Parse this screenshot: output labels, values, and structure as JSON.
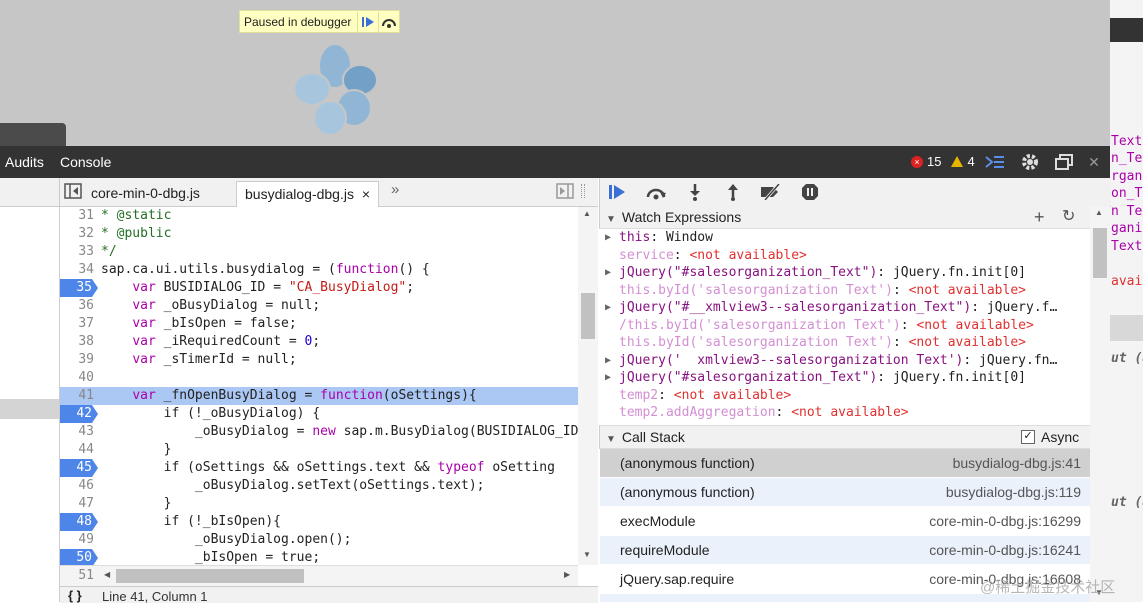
{
  "page": {
    "paused_label": "Paused in debugger"
  },
  "right_strip_text": [
    "Text",
    "n_Te",
    "rgan",
    "on_T",
    "n Te",
    "gani",
    "Text",
    "avai",
    "ut (a",
    "ut (a"
  ],
  "devtools": {
    "tabs": [
      "Audits",
      "Console"
    ],
    "error_count": "15",
    "warning_count": "4"
  },
  "sources": {
    "tabs": [
      "core-min-0-dbg.js",
      "busydialog-dbg.js"
    ],
    "close_glyph": "×",
    "overflow_glyph": "»",
    "status": "Line 41, Column 1",
    "status_icon": "{ }",
    "lines": [
      {
        "n": "31",
        "text": "* @static",
        "bp": false
      },
      {
        "n": "32",
        "text": "* @public",
        "bp": false
      },
      {
        "n": "33",
        "text": "*/",
        "bp": false
      },
      {
        "n": "34",
        "text": "sap.ca.ui.utils.busydialog = (function() {",
        "bp": false
      },
      {
        "n": "35",
        "text": "    var BUSIDIALOG_ID = \"CA_BusyDialog\";",
        "bp": true
      },
      {
        "n": "36",
        "text": "    var _oBusyDialog = null;",
        "bp": false
      },
      {
        "n": "37",
        "text": "    var _bIsOpen = false;",
        "bp": false
      },
      {
        "n": "38",
        "text": "    var _iRequiredCount = 0;",
        "bp": false
      },
      {
        "n": "39",
        "text": "    var _sTimerId = null;",
        "bp": false
      },
      {
        "n": "40",
        "text": "",
        "bp": false
      },
      {
        "n": "41",
        "text": "    var _fnOpenBusyDialog = function(oSettings){",
        "bp": false,
        "hl": true
      },
      {
        "n": "42",
        "text": "        if (!_oBusyDialog) {",
        "bp": true
      },
      {
        "n": "43",
        "text": "            _oBusyDialog = new sap.m.BusyDialog(BUSIDIALOG_ID",
        "bp": false
      },
      {
        "n": "44",
        "text": "        }",
        "bp": false
      },
      {
        "n": "45",
        "text": "        if (oSettings && oSettings.text && typeof oSetting",
        "bp": true
      },
      {
        "n": "46",
        "text": "            _oBusyDialog.setText(oSettings.text);",
        "bp": false
      },
      {
        "n": "47",
        "text": "        }",
        "bp": false
      },
      {
        "n": "48",
        "text": "        if (!_bIsOpen){",
        "bp": true
      },
      {
        "n": "49",
        "text": "            _oBusyDialog.open();",
        "bp": false
      },
      {
        "n": "50",
        "text": "            _bIsOpen = true;",
        "bp": true
      }
    ],
    "last_line": "51"
  },
  "watch": {
    "title": "Watch Expressions",
    "items": [
      {
        "expand": true,
        "key": "this",
        "sep": ": ",
        "val": "Window",
        "na": false,
        "dim": false
      },
      {
        "expand": false,
        "key": "service",
        "sep": ": ",
        "val": "<not available>",
        "na": true,
        "dim": true
      },
      {
        "expand": true,
        "key": "jQuery(\"#salesorganization_Text\")",
        "sep": ": ",
        "val": "jQuery.fn.init[0]",
        "na": false,
        "dim": false
      },
      {
        "expand": false,
        "key": "this.byId('salesorganization Text')",
        "sep": ": ",
        "val": "<not available>",
        "na": true,
        "dim": true
      },
      {
        "expand": true,
        "key": "jQuery(\"#__xmlview3--salesorganization_Text\")",
        "sep": ": ",
        "val": "jQuery.f…",
        "na": false,
        "dim": false
      },
      {
        "expand": false,
        "key": "/this.byId('salesorganization Text')",
        "sep": ": ",
        "val": "<not available>",
        "na": true,
        "dim": true
      },
      {
        "expand": false,
        "key": "this.byId('salesorganization Text')",
        "sep": ": ",
        "val": "<not available>",
        "na": true,
        "dim": true
      },
      {
        "expand": true,
        "key": "jQuery('  xmlview3--salesorganization Text')",
        "sep": ": ",
        "val": "jQuery.fn…",
        "na": false,
        "dim": false
      },
      {
        "expand": true,
        "key": "jQuery(\"#salesorganization_Text\")",
        "sep": ": ",
        "val": "jQuery.fn.init[0]",
        "na": false,
        "dim": false
      },
      {
        "expand": false,
        "key": "temp2",
        "sep": ": ",
        "val": "<not available>",
        "na": true,
        "dim": true
      },
      {
        "expand": false,
        "key": "temp2.addAggregation",
        "sep": ": ",
        "val": "<not available>",
        "na": true,
        "dim": true
      }
    ]
  },
  "callstack": {
    "title": "Call Stack",
    "async_label": "Async",
    "frames": [
      {
        "fn": "(anonymous function)",
        "loc": "busydialog-dbg.js:41"
      },
      {
        "fn": "(anonymous function)",
        "loc": "busydialog-dbg.js:119"
      },
      {
        "fn": "execModule",
        "loc": "core-min-0-dbg.js:16299"
      },
      {
        "fn": "requireModule",
        "loc": "core-min-0-dbg.js:16241"
      },
      {
        "fn": "jQuery.sap.require",
        "loc": "core-min-0-dbg.js:16608"
      },
      {
        "fn": "",
        "loc": ""
      }
    ]
  },
  "watermark": "@稀土掘金技术社区"
}
